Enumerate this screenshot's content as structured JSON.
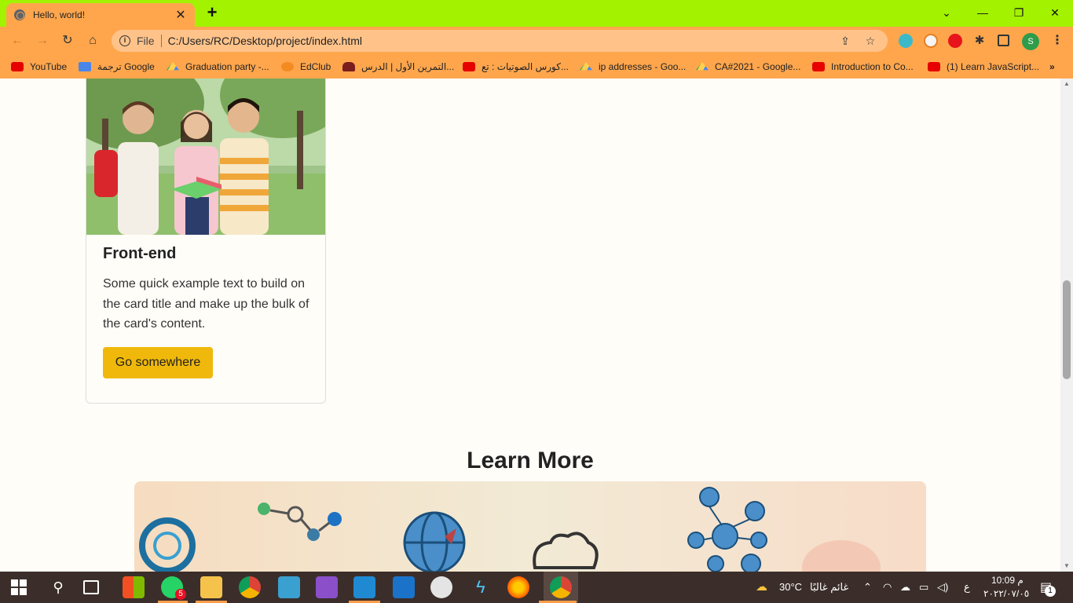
{
  "browser": {
    "tab_title": "Hello, world!",
    "tab_close": "✕",
    "new_tab": "+",
    "controls": {
      "dropdown": "⌄",
      "minimize": "—",
      "restore": "❐",
      "close": "✕"
    },
    "address": {
      "info": "i",
      "scheme_label": "File",
      "url": "C:/Users/RC/Desktop/project/index.html"
    },
    "nav": {
      "back": "←",
      "forward": "→",
      "reload": "↻",
      "home": "⌂"
    },
    "profile_initial": "S",
    "bookmarks": [
      {
        "label": "YouTube",
        "icon": "youtube-icon"
      },
      {
        "label": "ترجمة Google",
        "icon": "google-translate-icon"
      },
      {
        "label": "Graduation party -...",
        "icon": "google-drive-icon"
      },
      {
        "label": "EdClub",
        "icon": "edclub-icon"
      },
      {
        "label": "التمرين الأول | الدرس...",
        "icon": "hat-icon"
      },
      {
        "label": "كورس الصوتيات : تع...",
        "icon": "youtube-icon"
      },
      {
        "label": "ip addresses - Goo...",
        "icon": "google-drive-icon"
      },
      {
        "label": "CA#2021 - Google...",
        "icon": "google-drive-icon"
      },
      {
        "label": "Introduction to Co...",
        "icon": "youtube-icon"
      },
      {
        "label": "(1) Learn JavaScript...",
        "icon": "youtube-icon"
      }
    ],
    "bookmarks_more": "»"
  },
  "page": {
    "card": {
      "title": "Front-end",
      "text": "Some quick example text to build on the card title and make up the bulk of the card's content.",
      "button_label": "Go somewhere"
    },
    "section_heading": "Learn More",
    "scroll_position_percent": 41
  },
  "taskbar": {
    "whatsapp_badge": "5",
    "weather_temp": "30°C",
    "weather_text": "غائم غالبًا",
    "lang": "ع",
    "time": "10:09 م",
    "date": "٢٠٢٢/٠٧/٠٥",
    "notification_count": "1"
  },
  "colors": {
    "tab_strip": "#a3f200",
    "toolbar": "#ffa64d",
    "button": "#f0b80a",
    "taskbar": "#3b2e2a"
  }
}
